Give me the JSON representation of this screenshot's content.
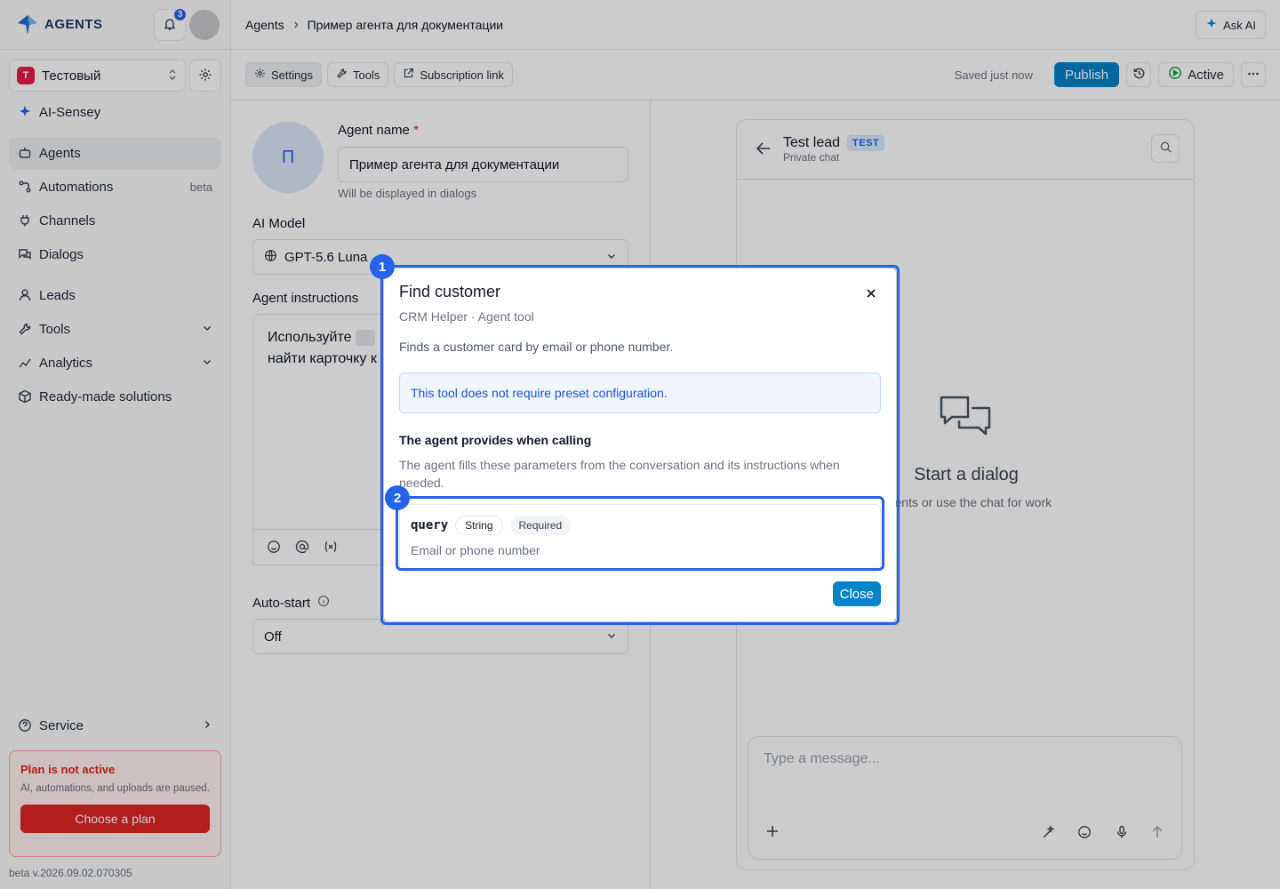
{
  "app": {
    "brand": "AGENTS",
    "notifications_count": "3"
  },
  "workspace": {
    "initial": "Т",
    "name": "Тестовый"
  },
  "sidebar": {
    "items": [
      {
        "label": "AI-Sensey",
        "icon": "sparkle-icon"
      },
      {
        "label": "Agents",
        "icon": "bot-icon",
        "active": true
      },
      {
        "label": "Automations",
        "icon": "workflow-icon",
        "badge": "beta"
      },
      {
        "label": "Channels",
        "icon": "plug-icon"
      },
      {
        "label": "Dialogs",
        "icon": "chat-icon"
      },
      {
        "label": "Leads",
        "icon": "user-icon"
      },
      {
        "label": "Tools",
        "icon": "wrench-icon"
      },
      {
        "label": "Analytics",
        "icon": "chart-icon"
      },
      {
        "label": "Ready-made solutions",
        "icon": "box-icon"
      }
    ],
    "service_label": "Service",
    "plan": {
      "title": "Plan is not active",
      "text": "AI, automations, and uploads are paused.",
      "button": "Choose a plan"
    },
    "version": "beta v.2026.09.02.070305"
  },
  "header": {
    "breadcrumb_root": "Agents",
    "breadcrumb_current": "Пример агента для документации",
    "ask_ai": "Ask AI"
  },
  "toolbar": {
    "tabs": [
      "Settings",
      "Tools",
      "Subscription link"
    ],
    "saved_text": "Saved just now",
    "publish": "Publish",
    "status": "Active"
  },
  "settings": {
    "avatar_initial": "П",
    "name_label": "Agent name",
    "required_mark": "*",
    "name_value": "Пример агента для документации",
    "name_hint": "Will be displayed in dialogs",
    "model_label": "AI Model",
    "model_value": "GPT-5.6 Luna",
    "instructions_label": "Agent instructions",
    "instructions_line1": "Используйте",
    "instructions_line2": "найти карточку к",
    "autostart_label": "Auto-start",
    "autostart_value": "Off"
  },
  "chat": {
    "title": "Test lead",
    "badge": "TEST",
    "subtitle": "Private chat",
    "empty_title": "Start a dialog",
    "empty_sub": "agents or use the chat for work",
    "composer_placeholder": "Type a message..."
  },
  "modal": {
    "title": "Find customer",
    "subtitle": "CRM Helper · Agent tool",
    "description": "Finds a customer card by email or phone number.",
    "info": "This tool does not require preset configuration.",
    "section_title": "The agent provides when calling",
    "section_text": "The agent fills these parameters from the conversation and its instructions when needed.",
    "param": {
      "name": "query",
      "type": "String",
      "required": "Required",
      "description": "Email or phone number"
    },
    "close_button": "Close"
  },
  "annotations": {
    "marker1": "1",
    "marker2": "2",
    "color": "#2563eb"
  }
}
